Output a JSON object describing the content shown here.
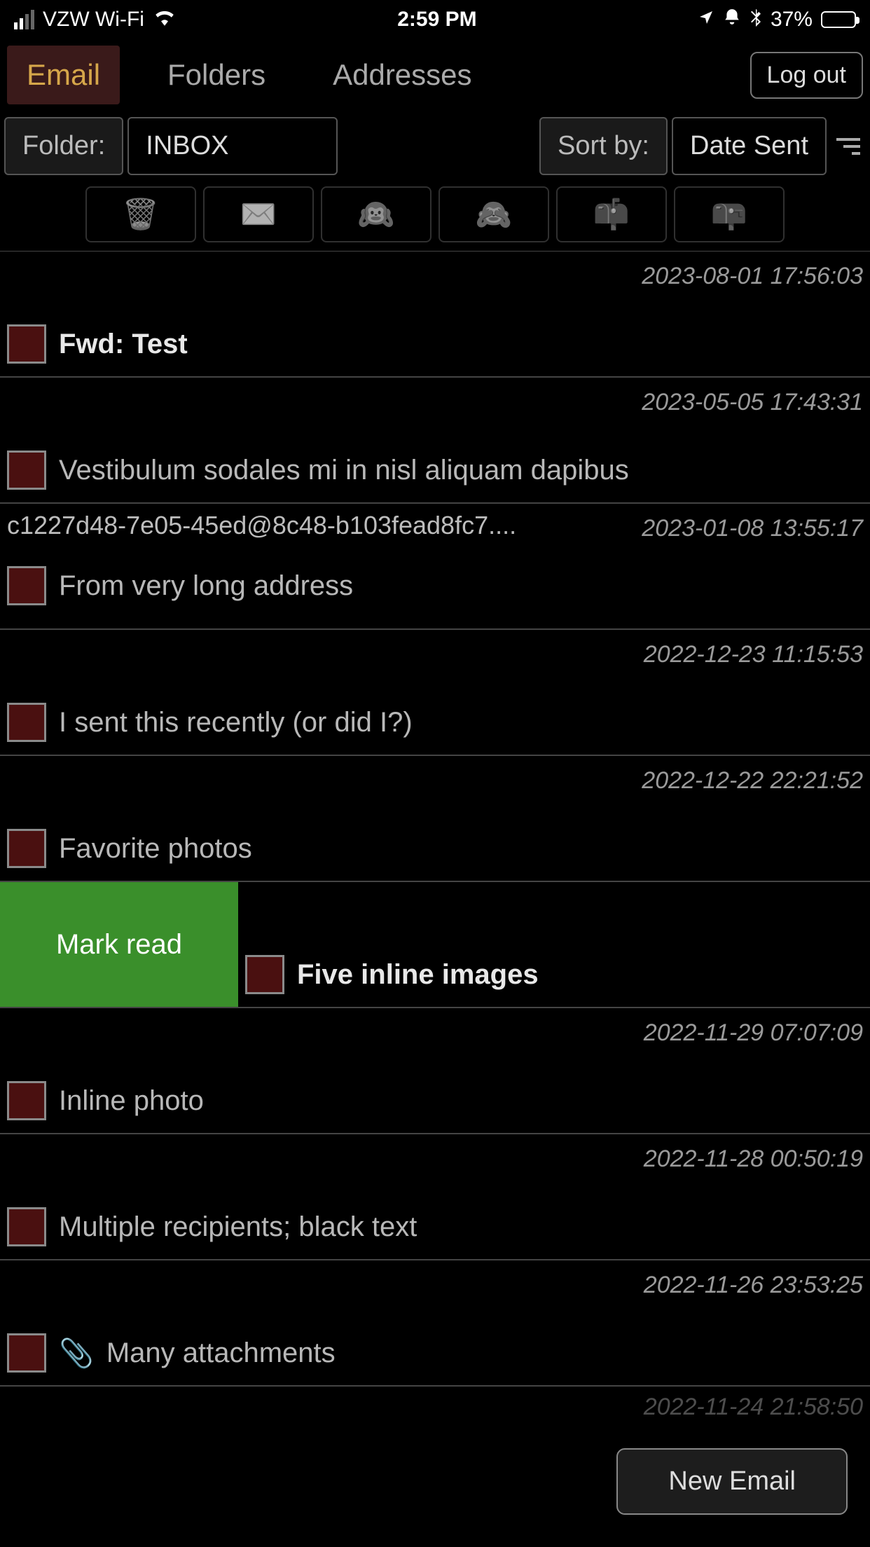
{
  "status": {
    "carrier": "VZW Wi-Fi",
    "time": "2:59 PM",
    "battery_pct": "37%"
  },
  "tabs": {
    "email": "Email",
    "folders": "Folders",
    "addresses": "Addresses"
  },
  "logout": "Log out",
  "filter": {
    "folder_label": "Folder:",
    "folder_value": "INBOX",
    "sort_label": "Sort by:",
    "sort_value": "Date Sent"
  },
  "toolbar_icons": {
    "trash": "🗑️",
    "envelope": "✉️",
    "see": "🙉",
    "nosee": "🙈",
    "mailbox1": "📫",
    "mailbox2": "📪"
  },
  "swipe_label": "Mark read",
  "new_email": "New Email",
  "messages": [
    {
      "sender": "",
      "sender_redacted": true,
      "sender_redact_w": 560,
      "timestamp": "2023-08-01 17:56:03",
      "subject": "Fwd: Test",
      "unread": true,
      "attach": false
    },
    {
      "sender": "",
      "sender_redacted": true,
      "sender_redact_w": 560,
      "timestamp": "2023-05-05 17:43:31",
      "subject": "Vestibulum sodales mi in nisl aliquam dapibus",
      "unread": false,
      "attach": false
    },
    {
      "sender": "c1227d48-7e05-45ed@8c48-b103fead8fc7....",
      "sender_redacted": false,
      "sender_redact_w": 0,
      "timestamp": "2023-01-08 13:55:17",
      "subject": "From very long address",
      "unread": false,
      "attach": false
    },
    {
      "sender": "",
      "sender_redacted": true,
      "sender_redact_w": 600,
      "timestamp": "2022-12-23 11:15:53",
      "subject": "I sent this recently (or did I?)",
      "unread": false,
      "attach": false
    },
    {
      "sender": "",
      "sender_redacted": true,
      "sender_redact_w": 520,
      "timestamp": "2022-12-22 22:21:52",
      "subject": "Favorite photos",
      "unread": false,
      "attach": false
    },
    {
      "sender": "",
      "sender_redacted": true,
      "sender_redact_w": 760,
      "timestamp": "",
      "subject": "Five inline images",
      "unread": true,
      "attach": false,
      "swiped": true
    },
    {
      "sender": "",
      "sender_redacted": true,
      "sender_redact_w": 640,
      "timestamp": "2022-11-29 07:07:09",
      "subject": "Inline photo",
      "unread": false,
      "attach": false
    },
    {
      "sender": "",
      "sender_redacted": true,
      "sender_redact_w": 680,
      "timestamp": "2022-11-28 00:50:19",
      "subject": "Multiple recipients; black text",
      "unread": false,
      "attach": false
    },
    {
      "sender": "",
      "sender_redacted": true,
      "sender_redact_w": 640,
      "timestamp": "2022-11-26 23:53:25",
      "subject": "Many attachments",
      "unread": false,
      "attach": true
    }
  ],
  "partial_timestamp": "2022-11-24 21:58:50"
}
